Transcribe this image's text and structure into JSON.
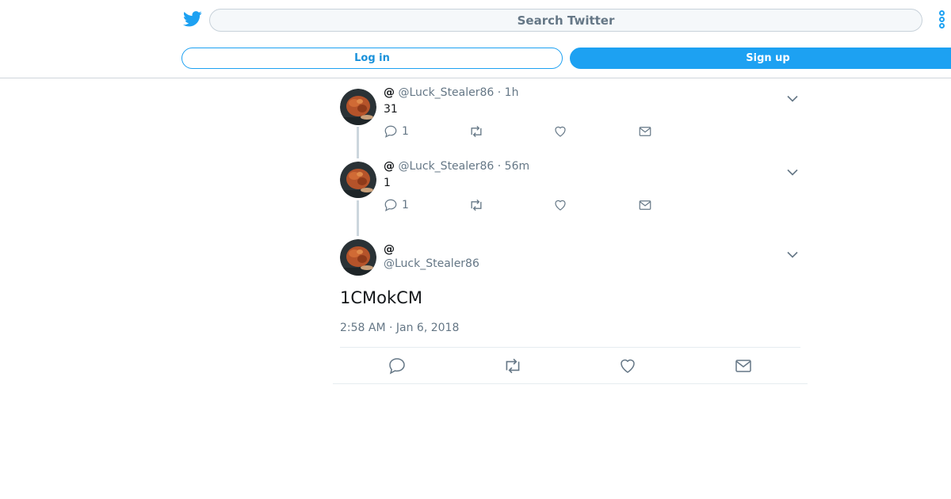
{
  "header": {
    "search_placeholder": "Search Twitter",
    "login_label": "Log in",
    "signup_label": "Sign up",
    "icons": {
      "logo": "twitter-bird-icon",
      "more": "more-vertical-icon"
    }
  },
  "tweets": [
    {
      "display_name": "@",
      "handle": "@Luck_Stealer86",
      "meta": "· 1h",
      "text": "31",
      "reply_count": "1"
    },
    {
      "display_name": "@",
      "handle": "@Luck_Stealer86",
      "meta": "· 56m",
      "text": "1",
      "reply_count": "1"
    }
  ],
  "main_tweet": {
    "display_name": "@",
    "handle": "@Luck_Stealer86",
    "text": "1CMokCM",
    "timestamp": "2:58 AM · Jan 6, 2018"
  },
  "colors": {
    "accent": "#1da1f2",
    "muted": "#657786",
    "text": "#14171a",
    "divider": "#e6ecf0"
  }
}
